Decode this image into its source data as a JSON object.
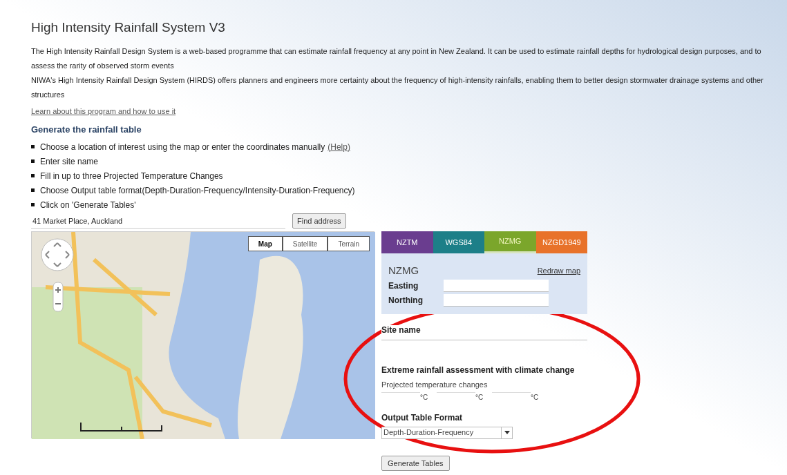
{
  "page": {
    "title": "High Intensity Rainfall System V3",
    "paragraphs": [
      "The High Intensity Rainfall Design System is a web-based programme that can estimate rainfall frequency at any point in New Zealand. It can be used to estimate rainfall depths for hydrological design purposes, and to assess the rarity of observed storm events",
      "NIWA's High Intensity Rainfall Design System (HIRDS) offers planners and engineers more certainty about the frequency of high-intensity rainfalls, enabling them to better design stormwater drainage systems and other structures"
    ],
    "learn_link": "Learn about this program and how to use it"
  },
  "steps": {
    "heading": "Generate the rainfall table",
    "items": [
      {
        "text": "Choose a location of interest using the map or enter the coordinates manually",
        "link": "(Help)"
      },
      {
        "text": "Enter site name"
      },
      {
        "text": "Fill in up to three Projected Temperature Changes"
      },
      {
        "text": "Choose Output table format(Depth-Duration-Frequency/Intensity-Duration-Frequency)"
      },
      {
        "text": "Click on 'Generate Tables'"
      }
    ]
  },
  "address": {
    "value": "41 Market Place, Auckland",
    "button": "Find address"
  },
  "map": {
    "types": [
      {
        "label": "Map",
        "selected": true
      },
      {
        "label": "Satellite",
        "selected": false
      },
      {
        "label": "Terrain",
        "selected": false
      }
    ]
  },
  "coordinates": {
    "tabs": [
      {
        "label": "NZTM",
        "color": "#6a3d8f",
        "selected": false
      },
      {
        "label": "WGS84",
        "color": "#1d7f88",
        "selected": false
      },
      {
        "label": "NZMG",
        "color": "#7ba62b",
        "selected": true
      },
      {
        "label": "NZGD1949",
        "color": "#e8722a",
        "selected": false
      }
    ],
    "system": "NZMG",
    "redraw": "Redraw map",
    "fields": [
      "Easting",
      "Northing"
    ]
  },
  "site_name_label": "Site name",
  "climate": {
    "heading": "Extreme rainfall assessment with climate change",
    "subheading": "Projected temperature changes",
    "units": [
      "°C",
      "°C",
      "°C"
    ]
  },
  "output": {
    "heading": "Output Table Format",
    "value": "Depth-Duration-Frequency"
  },
  "generate_button": "Generate Tables"
}
